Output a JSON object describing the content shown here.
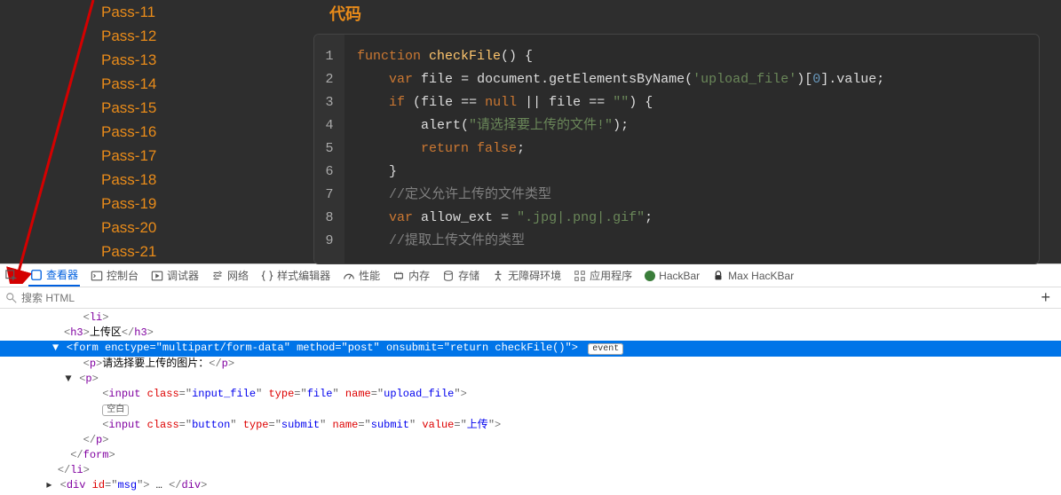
{
  "sidebar": {
    "items": [
      {
        "label": "Pass-11"
      },
      {
        "label": "Pass-12"
      },
      {
        "label": "Pass-13"
      },
      {
        "label": "Pass-14"
      },
      {
        "label": "Pass-15"
      },
      {
        "label": "Pass-16"
      },
      {
        "label": "Pass-17"
      },
      {
        "label": "Pass-18"
      },
      {
        "label": "Pass-19"
      },
      {
        "label": "Pass-20"
      },
      {
        "label": "Pass-21"
      }
    ]
  },
  "code": {
    "title": "代码",
    "lines": [
      {
        "n": "1"
      },
      {
        "n": "2"
      },
      {
        "n": "3"
      },
      {
        "n": "4"
      },
      {
        "n": "5"
      },
      {
        "n": "6"
      },
      {
        "n": "7"
      },
      {
        "n": "8"
      },
      {
        "n": "9"
      }
    ],
    "tokens": {
      "function": "function",
      "checkFile": "checkFile",
      "var": "var",
      "file_var": "file",
      "document": "document",
      "getElementsByName": "getElementsByName",
      "upload_file_str": "'upload_file'",
      "zero": "0",
      "value": "value",
      "if": "if",
      "null": "null",
      "empty_str": "\"\"",
      "alert": "alert",
      "alert_str": "\"请选择要上传的文件!\"",
      "return": "return",
      "false": "false",
      "comment1": "//定义允许上传的文件类型",
      "allow_ext": "allow_ext",
      "ext_str": "\".jpg|.png|.gif\"",
      "comment2": "//提取上传文件的类型"
    }
  },
  "devtools": {
    "tabs": {
      "inspector": "查看器",
      "console": "控制台",
      "debugger": "调试器",
      "network": "网络",
      "style_editor": "样式编辑器",
      "performance": "性能",
      "memory": "内存",
      "storage": "存储",
      "accessibility": "无障碍环境",
      "application": "应用程序",
      "hackbar": "HackBar",
      "max_hackbar": "Max HacKBar"
    },
    "search_placeholder": "搜索 HTML",
    "dom": {
      "li_open": "<li>",
      "h3_open": "<h3>",
      "h3_text": "上传区",
      "h3_close": "</h3>",
      "form_tag": "form",
      "form_enctype_attr": "enctype",
      "form_enctype_val": "multipart/form-data",
      "form_method_attr": "method",
      "form_method_val": "post",
      "form_onsubmit_attr": "onsubmit",
      "form_onsubmit_val": "return checkFile()",
      "event_badge": "event",
      "p1_open": "<p>",
      "p1_text": "请选择要上传的图片：",
      "p1_close": "</p>",
      "p2_open": "<p>",
      "input1_tag": "input",
      "input1_class_attr": "class",
      "input1_class_val": "input_file",
      "input1_type_attr": "type",
      "input1_type_val": "file",
      "input1_name_attr": "name",
      "input1_name_val": "upload_file",
      "whitespace_badge": "空白",
      "input2_tag": "input",
      "input2_class_attr": "class",
      "input2_class_val": "button",
      "input2_type_attr": "type",
      "input2_type_val": "submit",
      "input2_name_attr": "name",
      "input2_name_val": "submit",
      "input2_value_attr": "value",
      "input2_value_val": "上传",
      "p2_close": "</p>",
      "form_close": "</form>",
      "li_close": "</li>",
      "div_tag": "div",
      "div_id_attr": "id",
      "div_id_val": "msg",
      "div_close": "</div>"
    }
  }
}
